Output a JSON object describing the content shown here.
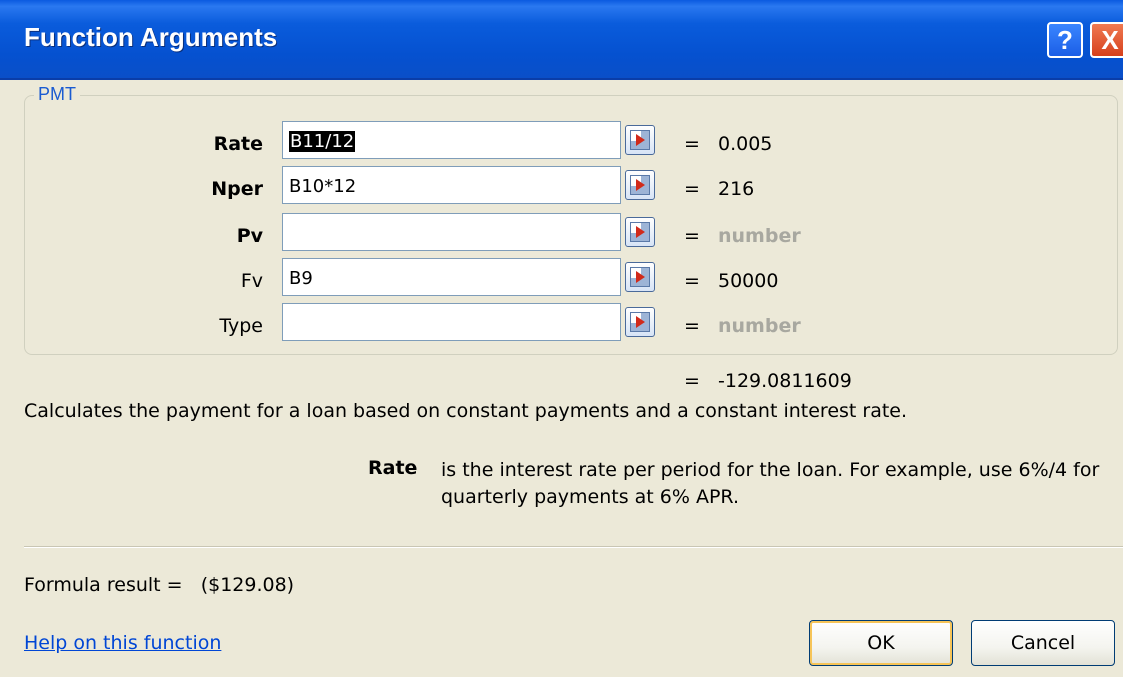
{
  "window": {
    "title": "Function Arguments",
    "help_glyph": "?",
    "close_glyph": "X"
  },
  "function_group": {
    "name": "PMT",
    "args": [
      {
        "label": "Rate",
        "value": "B11/12",
        "value_selected": true,
        "evaluated": "0.005",
        "required": true,
        "placeholder": false
      },
      {
        "label": "Nper",
        "value": "B10*12",
        "value_selected": false,
        "evaluated": "216",
        "required": true,
        "placeholder": false
      },
      {
        "label": "Pv",
        "value": "",
        "value_selected": false,
        "evaluated": "number",
        "required": true,
        "placeholder": true
      },
      {
        "label": "Fv",
        "value": "B9",
        "value_selected": false,
        "evaluated": "50000",
        "required": false,
        "placeholder": false
      },
      {
        "label": "Type",
        "value": "",
        "value_selected": false,
        "evaluated": "number",
        "required": false,
        "placeholder": true
      }
    ],
    "equals": "="
  },
  "result": {
    "equals": "=",
    "value": "-129.0811609"
  },
  "description": "Calculates the payment for a loan based on constant payments and a constant interest rate.",
  "arg_help": {
    "name": "Rate",
    "text": "is the interest rate per period for the loan. For example, use 6%/4 for quarterly payments at 6% APR."
  },
  "formula_result": "Formula result =   ($129.08)",
  "help_link": "Help on this function",
  "buttons": {
    "ok": "OK",
    "cancel": "Cancel"
  },
  "colors": {
    "title_bar": "#0a5cdc",
    "dialog_bg": "#ece9d8",
    "link": "#0046d5",
    "hint_text": "#a8a8a0",
    "group_label": "#1a5bd1"
  },
  "icons": {
    "help": "help-icon",
    "close": "close-icon",
    "ref_edit": "collapse-dialog-icon"
  }
}
